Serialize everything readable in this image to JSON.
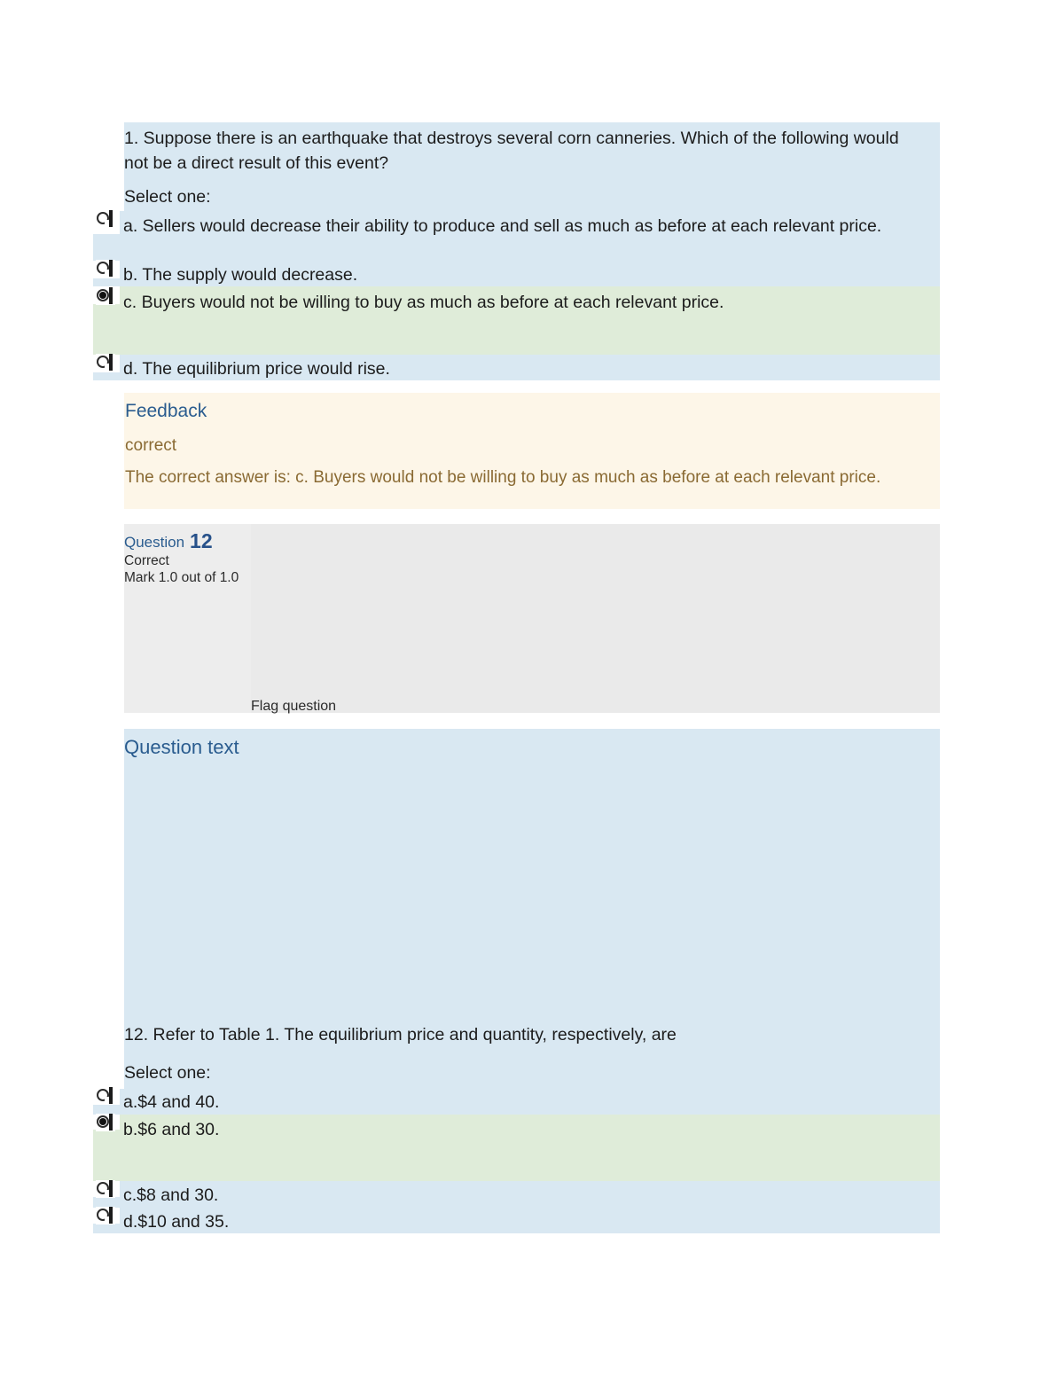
{
  "colors": {
    "answer_blue": "#d9e8f2",
    "answer_green": "#dfecd9",
    "feedback_cream": "#fdf6e8",
    "question_header_gray": "#ededed",
    "heading_blue": "#2a5c8f",
    "feedback_text_brown": "#8a6a33"
  },
  "question1": {
    "stem": "1. Suppose there is an earthquake that destroys several corn canneries. Which of the following would not be a direct result of this event?",
    "select_one_label": "Select one:",
    "options": [
      {
        "letter": "a.",
        "text": "a. Sellers would decrease their ability to produce and sell as much as before at each relevant price.",
        "selected": false,
        "state": "neutral"
      },
      {
        "letter": "b.",
        "text": "b. The supply would decrease.",
        "selected": false,
        "state": "neutral"
      },
      {
        "letter": "c.",
        "text": "c. Buyers would not be willing to buy as much as before at each relevant price.",
        "selected": true,
        "state": "correct"
      },
      {
        "letter": "d.",
        "text": "d. The equilibrium price would rise.",
        "selected": false,
        "state": "neutral"
      }
    ],
    "feedback": {
      "title": "Feedback",
      "verdict": "correct",
      "correct_answer": "The correct answer is: c. Buyers would not be willing to buy as much as before at each relevant price."
    }
  },
  "question12": {
    "header": {
      "label": "Question",
      "number": "12",
      "state": "Correct",
      "mark": "Mark 1.0 out of 1.0",
      "flag_label": "Flag question"
    },
    "question_text_heading": "Question text",
    "stem": "12. Refer to Table 1. The equilibrium price and quantity, respectively, are",
    "select_one_label": "Select one:",
    "options": [
      {
        "letter": "a.",
        "text": "a.$4 and 40.",
        "selected": false,
        "state": "neutral"
      },
      {
        "letter": "b.",
        "text": "b.$6 and 30.",
        "selected": true,
        "state": "correct"
      },
      {
        "letter": "c.",
        "text": "c.$8 and 30.",
        "selected": false,
        "state": "neutral"
      },
      {
        "letter": "d.",
        "text": "d.$10 and 35.",
        "selected": false,
        "state": "neutral"
      }
    ]
  }
}
